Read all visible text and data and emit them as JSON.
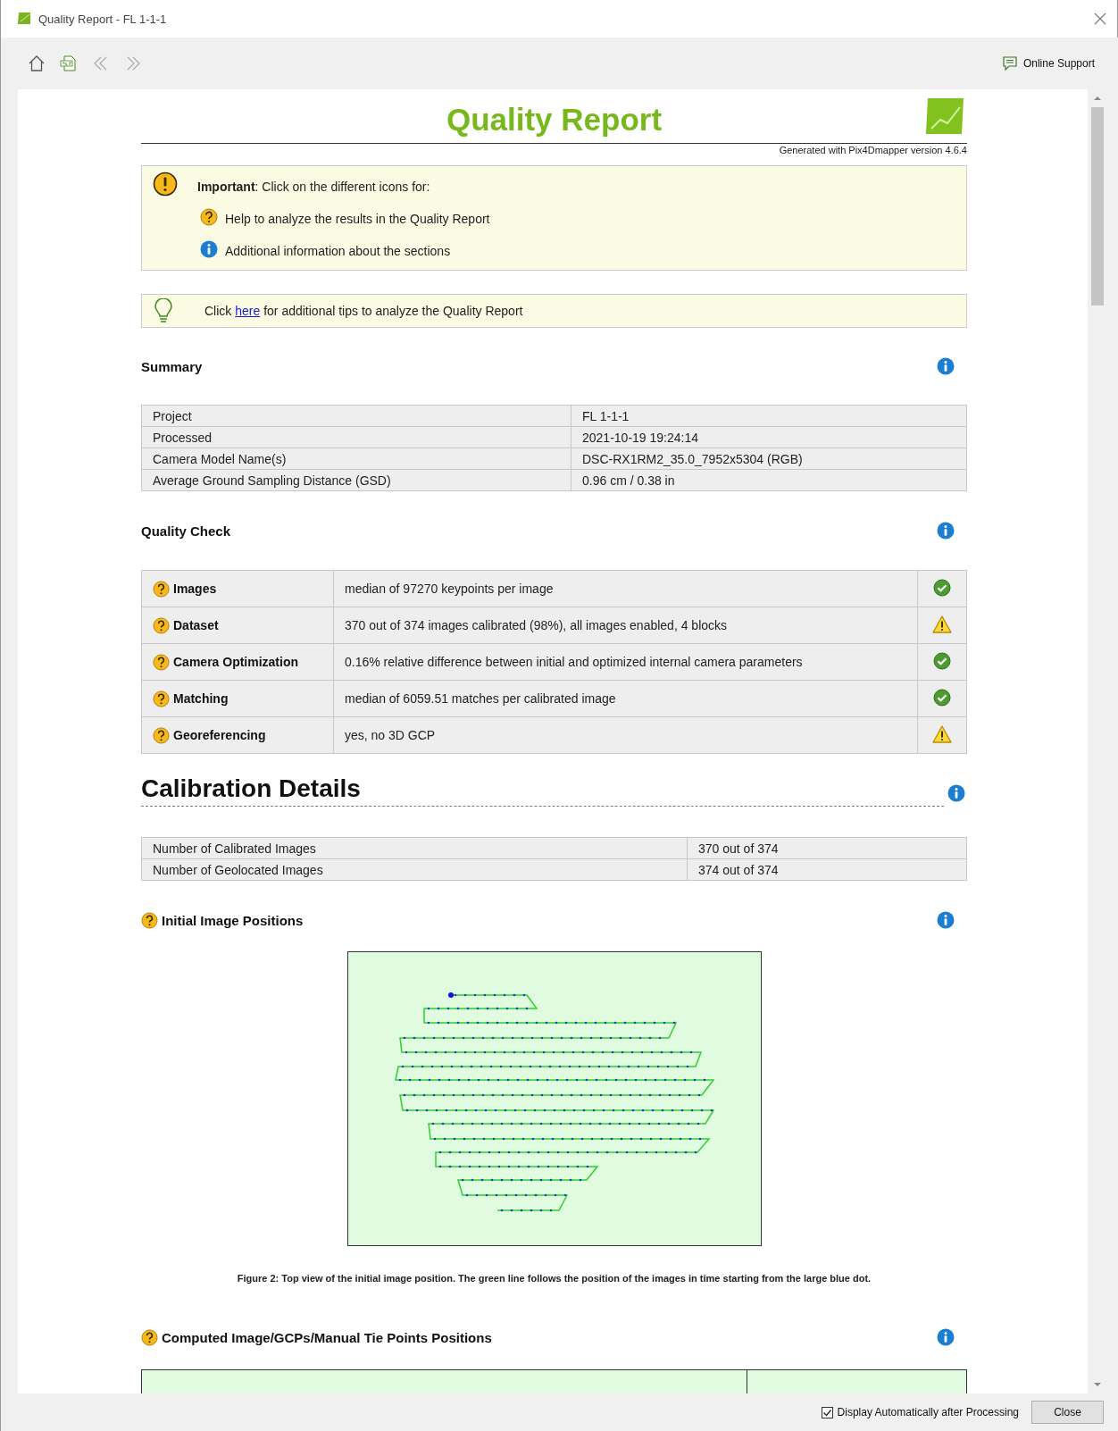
{
  "window": {
    "title": "Quality Report - FL 1-1-1"
  },
  "toolbar": {
    "online_support": "Online Support"
  },
  "report": {
    "title": "Quality Report",
    "generated": "Generated with Pix4Dmapper version 4.6.4",
    "important": {
      "text": "**Important**: Click on the different icons for:",
      "items": [
        {
          "kind": "help",
          "text": "Help to analyze the results in the Quality Report"
        },
        {
          "kind": "info",
          "text": "Additional information about the sections"
        }
      ]
    },
    "tip": {
      "before": "Click",
      "link": "here",
      "after": "for additional tips to analyze the Quality Report"
    },
    "summary": {
      "title": "Summary",
      "rows": [
        [
          "Project",
          "FL 1-1-1"
        ],
        [
          "Processed",
          "2021-10-19 19:24:14"
        ],
        [
          "Camera Model Name(s)",
          "DSC-RX1RM2_35.0_7952x5304 (RGB)"
        ],
        [
          "Average Ground Sampling Distance (GSD)",
          "0.96 cm / 0.38 in"
        ]
      ]
    },
    "quality_check": {
      "title": "Quality Check",
      "rows": [
        {
          "label": "Images",
          "value": "median of 97270 keypoints per image",
          "kind": "ok"
        },
        {
          "label": "Dataset",
          "value": "370 out of 374 images calibrated (98%), all images enabled, 4 blocks",
          "kind": "warning"
        },
        {
          "label": "Camera Optimization",
          "value": "0.16% relative difference between initial and optimized internal camera parameters",
          "kind": "ok"
        },
        {
          "label": "Matching",
          "value": "median of 6059.51 matches per calibrated image",
          "kind": "ok"
        },
        {
          "label": "Georeferencing",
          "value": "yes, no 3D GCP",
          "kind": "warning"
        }
      ]
    },
    "calibration": {
      "title": "Calibration Details",
      "rows": [
        [
          "Number of Calibrated Images",
          "370 out of 374"
        ],
        [
          "Number of Geolocated Images",
          "374 out of 374"
        ]
      ]
    },
    "initial_positions": {
      "title": "Initial Image Positions",
      "caption": "Figure 2: Top view of the initial image position. The green line follows the position of the images in time starting from the large blue dot."
    },
    "computed_positions": {
      "title": "Computed Image/GCPs/Manual Tie Points Positions"
    }
  },
  "footer": {
    "display_auto": {
      "label": "Display Automatically after Processing",
      "checked": true
    },
    "close": "Close"
  }
}
